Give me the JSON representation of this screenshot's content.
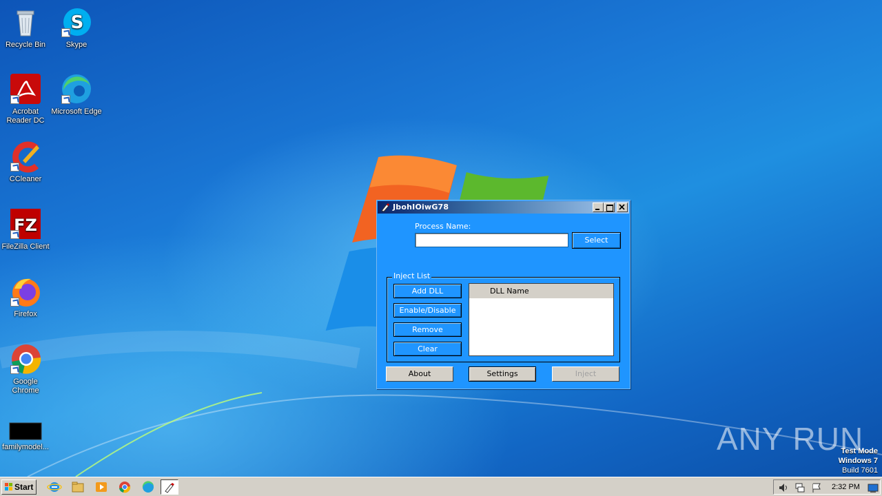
{
  "desktop": {
    "icons": [
      {
        "label": "Recycle Bin",
        "icon": "recycle-bin-icon"
      },
      {
        "label": "Skype",
        "icon": "skype-icon"
      },
      {
        "label": "Acrobat Reader DC",
        "icon": "acrobat-icon"
      },
      {
        "label": "Microsoft Edge",
        "icon": "edge-icon"
      },
      {
        "label": "CCleaner",
        "icon": "ccleaner-icon"
      },
      {
        "label": "FileZilla Client",
        "icon": "filezilla-icon"
      },
      {
        "label": "Firefox",
        "icon": "firefox-icon"
      },
      {
        "label": "Google Chrome",
        "icon": "chrome-icon"
      },
      {
        "label": "familymodel...",
        "icon": "file-thumbnail-icon"
      }
    ]
  },
  "dialog": {
    "title": "JbohIOiwG78",
    "process_name_label": "Process Name:",
    "process_name_value": "",
    "select_label": "Select",
    "inject_list_label": "Inject List",
    "add_dll_label": "Add DLL",
    "enable_disable_label": "Enable/Disable",
    "remove_label": "Remove",
    "clear_label": "Clear",
    "dll_column_header": "DLL Name",
    "about_label": "About",
    "settings_label": "Settings",
    "inject_label": "Inject"
  },
  "watermark": {
    "brand": "ANY RUN",
    "mode": "Test Mode",
    "os": "Windows 7",
    "build": "Build 7601"
  },
  "taskbar": {
    "start_label": "Start",
    "clock": "2:32 PM"
  }
}
